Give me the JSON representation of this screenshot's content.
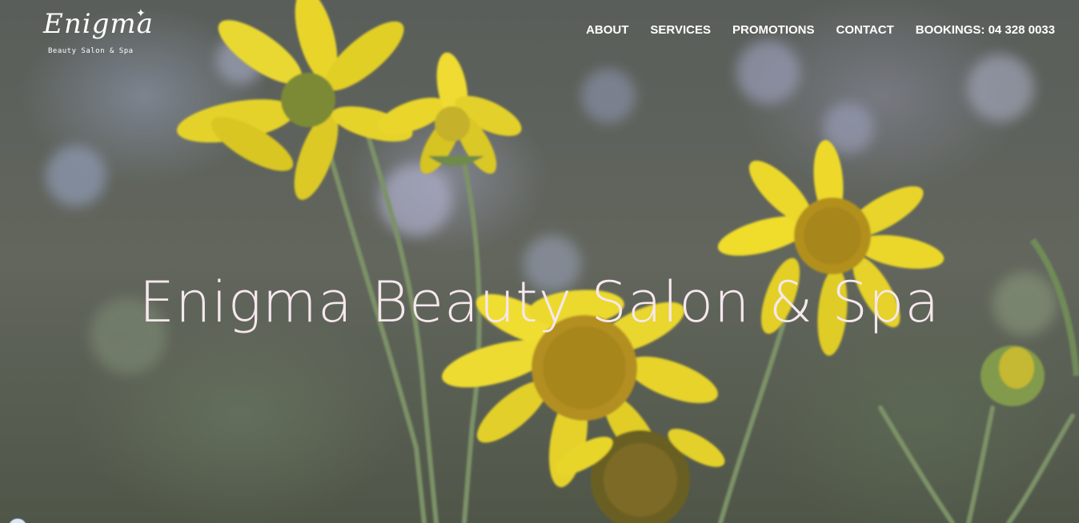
{
  "brand": {
    "logo_word": "Enigma",
    "logo_star": "✦",
    "tagline": "Beauty Salon & Spa"
  },
  "nav": {
    "items": [
      {
        "label": "ABOUT"
      },
      {
        "label": "SERVICES"
      },
      {
        "label": "PROMOTIONS"
      },
      {
        "label": "CONTACT"
      },
      {
        "label": "BOOKINGS: 04 328 0033"
      }
    ]
  },
  "hero": {
    "title": "Enigma Beauty Salon & Spa",
    "background": "yellow-flowers-photo"
  },
  "colors": {
    "nav_text": "#ffffff",
    "title_text": "#f6e8ee",
    "petal": "#e8d428",
    "flower_center": "#a8861c",
    "stem": "#7d9268"
  }
}
